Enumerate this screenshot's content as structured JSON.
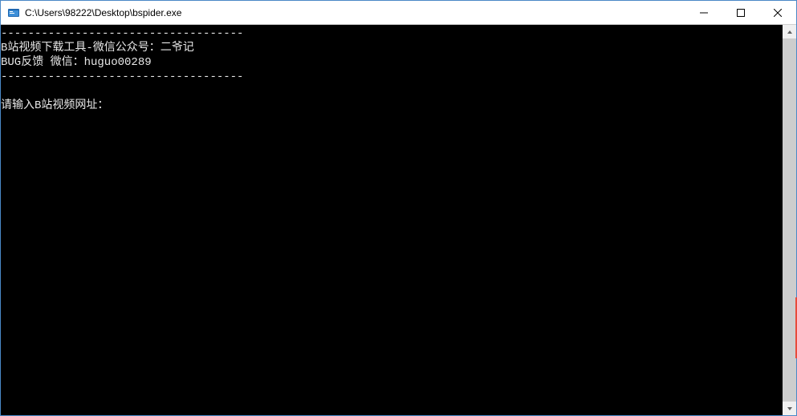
{
  "window": {
    "title": "C:\\Users\\98222\\Desktop\\bspider.exe"
  },
  "console": {
    "lines": [
      "------------------------------------",
      "B站视频下载工具-微信公众号：二爷记",
      "BUG反馈 微信：huguo00289",
      "------------------------------------",
      "",
      "请输入B站视频网址："
    ]
  }
}
